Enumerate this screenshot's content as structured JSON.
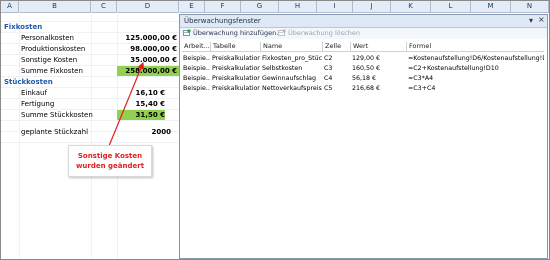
{
  "columns": [
    "A",
    "B",
    "C",
    "D",
    "E",
    "F",
    "G",
    "H",
    "I",
    "J",
    "K",
    "L",
    "M",
    "N"
  ],
  "sheet": {
    "fixkosten_header": "Fixkosten",
    "rows_fix": [
      {
        "label": "Personalkosten",
        "value": "125.000,00 €"
      },
      {
        "label": "Produktionskosten",
        "value": "98.000,00 €"
      },
      {
        "label": "Sonstige Kosten",
        "value": "35.000,00 €"
      },
      {
        "label": "Summe Fixkosten",
        "value": "258.000,00 €"
      }
    ],
    "stueckkosten_header": "Stückkosten",
    "rows_stk": [
      {
        "label": "Einkauf",
        "value": "16,10 €"
      },
      {
        "label": "Fertigung",
        "value": "15,40 €"
      },
      {
        "label": "Summe Stückkosten",
        "value": "31,50 €"
      }
    ],
    "stueckzahl_label": "geplante Stückzahl",
    "stueckzahl_value": "2000",
    "highlight_color": "#92d050"
  },
  "callout": {
    "line1": "Sonstige Kosten",
    "line2": "wurden geändert",
    "color": "#e02020"
  },
  "watch_window": {
    "title": "Überwachungsfenster",
    "add_label": "Überwachung hinzufügen...",
    "delete_label": "Überwachung löschen",
    "headers": [
      "Arbeit...",
      "Tabelle",
      "Name",
      "Zelle",
      "Wert",
      "Formel"
    ],
    "rows": [
      [
        "Beispie...",
        "Preiskalkulation",
        "Fixkosten_pro_Stück",
        "C2",
        "129,00 €",
        "=Kostenaufstellung!D6/Kostenaufstellung!D12"
      ],
      [
        "Beispie...",
        "Preiskalkulation",
        "Selbstkosten",
        "C3",
        "160,50 €",
        "=C2+Kostenaufstellung!D10"
      ],
      [
        "Beispie...",
        "Preiskalkulation",
        "Gewinnaufschlag",
        "C4",
        "56,18 €",
        "=C3*A4"
      ],
      [
        "Beispie...",
        "Preiskalkulation",
        "Nettoverkaufspreis",
        "C5",
        "216,68 €",
        "=C3+C4"
      ]
    ]
  }
}
